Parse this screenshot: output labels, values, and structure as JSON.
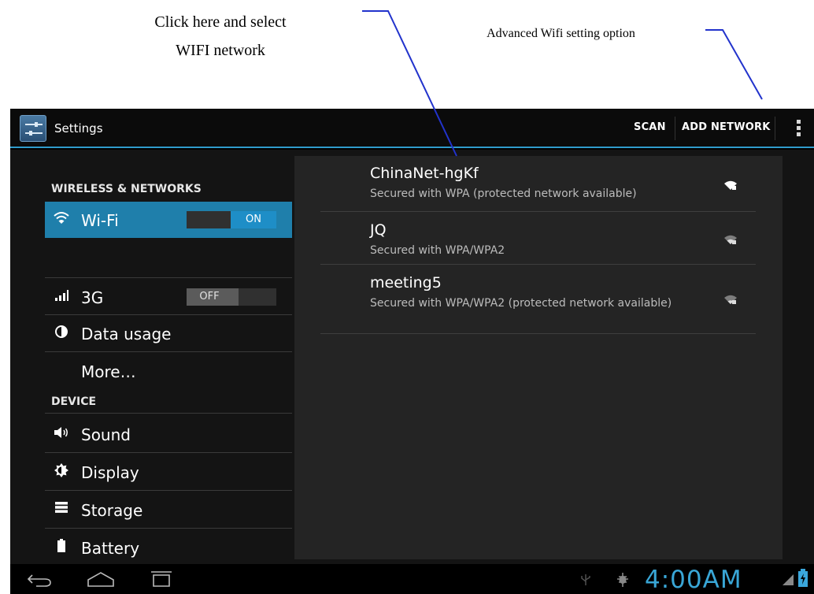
{
  "annotations": {
    "select_line1": "Click here and select",
    "select_line2": "WIFI network",
    "advanced": "Advanced Wifi setting option"
  },
  "action_bar": {
    "title": "Settings",
    "scan": "SCAN",
    "add_network": "ADD NETWORK"
  },
  "sidebar": {
    "wireless_header": "WIRELESS & NETWORKS",
    "device_header": "DEVICE",
    "wifi": {
      "label": "Wi-Fi",
      "toggle": "ON"
    },
    "mobile": {
      "label": "3G",
      "toggle": "OFF"
    },
    "data_usage": "Data usage",
    "more": "More…",
    "sound": "Sound",
    "display": "Display",
    "storage": "Storage",
    "battery": "Battery"
  },
  "networks": [
    {
      "name": "ChinaNet-hgKf",
      "status": "Secured with WPA (protected network available)"
    },
    {
      "name": "JQ",
      "status": "Secured with WPA/WPA2"
    },
    {
      "name": "meeting5",
      "status": "Secured with WPA/WPA2 (protected network available)"
    }
  ],
  "status_bar": {
    "time": "4:00AM"
  },
  "colors": {
    "accent": "#2f9bcb",
    "selected_row": "#1f7fab",
    "clock": "#39a6d6"
  }
}
